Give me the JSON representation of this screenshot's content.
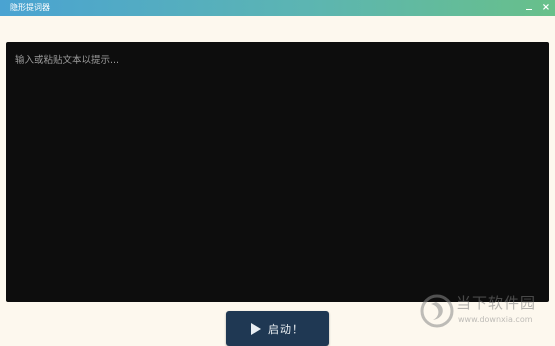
{
  "window": {
    "title": "隐形提词器"
  },
  "editor": {
    "placeholder": "输入或粘贴文本以提示..."
  },
  "start_button": {
    "label": "启动！"
  },
  "watermark": {
    "brand": "当下软件园",
    "url": "www.downxia.com"
  }
}
